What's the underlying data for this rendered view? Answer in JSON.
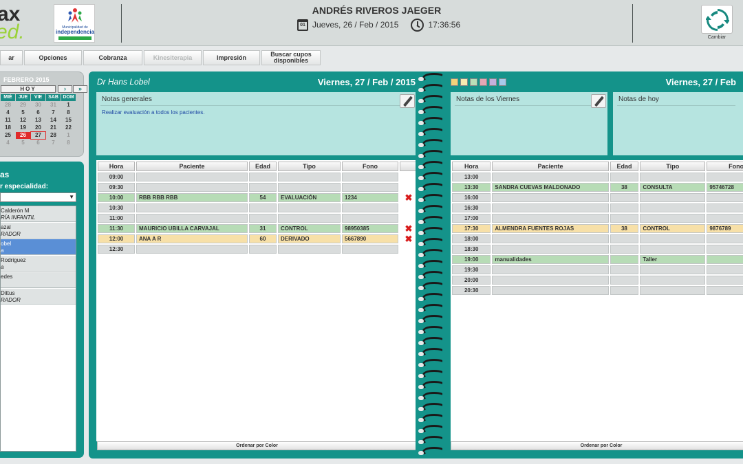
{
  "header": {
    "logo_line1": "ax",
    "logo_line2": "ed.",
    "muni_line1": "Municipalidad de",
    "muni_line2": "independencia",
    "user_name": "ANDRÉS RIVEROS JAEGER",
    "cal_icon_text": "01",
    "date": "Jueves, 26 / Feb / 2015",
    "time": "17:36:56",
    "cambiar_label": "Cambiar"
  },
  "toolbar": [
    {
      "label": "ar",
      "disabled": false
    },
    {
      "label": "Opciones",
      "disabled": false
    },
    {
      "label": "Cobranza",
      "disabled": false
    },
    {
      "label": "Kinesiterapia",
      "disabled": true
    },
    {
      "label": "Impresión",
      "disabled": false
    },
    {
      "label": "Buscar cupos disponibles",
      "disabled": false
    }
  ],
  "calendar": {
    "month": "FEBRERO 2015",
    "hoy": "HOY",
    "next": "›",
    "fast_next": "»",
    "headers": [
      "MIÉ",
      "JUE",
      "VIE",
      "SAB",
      "DOM"
    ],
    "weeks": [
      [
        "28",
        "29",
        "30",
        "31",
        "1"
      ],
      [
        "4",
        "5",
        "6",
        "7",
        "8"
      ],
      [
        "11",
        "12",
        "13",
        "14",
        "15"
      ],
      [
        "18",
        "19",
        "20",
        "21",
        "22"
      ],
      [
        "25",
        "26",
        "27",
        "28",
        "1"
      ],
      [
        "4",
        "5",
        "6",
        "7",
        "8"
      ]
    ]
  },
  "specialists": {
    "title": "as",
    "filter_label": "r especialidad:",
    "items": [
      {
        "name": "Calderón M",
        "spec": "RÍA INFANTIL"
      },
      {
        "name": "azal",
        "spec": "RADOR"
      },
      {
        "name": "obel",
        "spec": "a"
      },
      {
        "name": "Rodriguez",
        "spec": "a"
      },
      {
        "name": "edes",
        "spec": ""
      },
      {
        "name": "Dittus",
        "spec": "RADOR"
      }
    ]
  },
  "left_agenda": {
    "doctor": "Dr Hans Lobel",
    "date": "Viernes, 27 / Feb / 2015",
    "notes_title": "Notas generales",
    "notes_text": "Realizar evaluación a todos los pacientes.",
    "columns": [
      "Hora",
      "Paciente",
      "Edad",
      "Tipo",
      "Fono",
      ""
    ],
    "rows": [
      {
        "hora": "09:00",
        "paciente": "",
        "edad": "",
        "tipo": "",
        "fono": "",
        "del": "",
        "color": ""
      },
      {
        "hora": "09:30",
        "paciente": "",
        "edad": "",
        "tipo": "",
        "fono": "",
        "del": "",
        "color": ""
      },
      {
        "hora": "10:00",
        "paciente": "RBB RBB RBB",
        "edad": "54",
        "tipo": "EVALUACIÓN",
        "fono": "1234",
        "del": "✖",
        "color": "green"
      },
      {
        "hora": "10:30",
        "paciente": "",
        "edad": "",
        "tipo": "",
        "fono": "",
        "del": "",
        "color": ""
      },
      {
        "hora": "11:00",
        "paciente": "",
        "edad": "",
        "tipo": "",
        "fono": "",
        "del": "",
        "color": ""
      },
      {
        "hora": "11:30",
        "paciente": "MAURICIO UBILLA CARVAJAL",
        "edad": "31",
        "tipo": "CONTROL",
        "fono": "98950385",
        "del": "✖",
        "color": "green"
      },
      {
        "hora": "12:00",
        "paciente": "ANA A R",
        "edad": "60",
        "tipo": "DERIVADO",
        "fono": "5667890",
        "del": "✖",
        "color": "yellow"
      },
      {
        "hora": "12:30",
        "paciente": "",
        "edad": "",
        "tipo": "",
        "fono": "",
        "del": "",
        "color": ""
      }
    ],
    "order_label": "Ordenar por Color"
  },
  "right_agenda": {
    "date": "Viernes, 27 / Feb",
    "notes1_title": "Notas de los Viernes",
    "notes2_title": "Notas de hoy",
    "swatches": [
      "#f3d27a",
      "#f7eab0",
      "#b9dfb8",
      "#e4a7b5",
      "#c5b0dc",
      "#a9c9ea"
    ],
    "columns": [
      "Hora",
      "Paciente",
      "Edad",
      "Tipo",
      "Fono"
    ],
    "rows": [
      {
        "hora": "13:00",
        "paciente": "",
        "edad": "",
        "tipo": "",
        "fono": "",
        "color": ""
      },
      {
        "hora": "13:30",
        "paciente": "SANDRA CUEVAS MALDONADO",
        "edad": "38",
        "tipo": "CONSULTA",
        "fono": "95746728",
        "color": "green"
      },
      {
        "hora": "16:00",
        "paciente": "",
        "edad": "",
        "tipo": "",
        "fono": "",
        "color": ""
      },
      {
        "hora": "16:30",
        "paciente": "",
        "edad": "",
        "tipo": "",
        "fono": "",
        "color": ""
      },
      {
        "hora": "17:00",
        "paciente": "",
        "edad": "",
        "tipo": "",
        "fono": "",
        "color": ""
      },
      {
        "hora": "17:30",
        "paciente": "ALMENDRA FUENTES ROJAS",
        "edad": "38",
        "tipo": "CONTROL",
        "fono": "9876789",
        "color": "yellow"
      },
      {
        "hora": "18:00",
        "paciente": "",
        "edad": "",
        "tipo": "",
        "fono": "",
        "color": ""
      },
      {
        "hora": "18:30",
        "paciente": "",
        "edad": "",
        "tipo": "",
        "fono": "",
        "color": ""
      },
      {
        "hora": "19:00",
        "paciente": "manualidades",
        "edad": "",
        "tipo": "Taller",
        "fono": "",
        "color": "green"
      },
      {
        "hora": "19:30",
        "paciente": "",
        "edad": "",
        "tipo": "",
        "fono": "",
        "color": ""
      },
      {
        "hora": "20:00",
        "paciente": "",
        "edad": "",
        "tipo": "",
        "fono": "",
        "color": ""
      },
      {
        "hora": "20:30",
        "paciente": "",
        "edad": "",
        "tipo": "",
        "fono": "",
        "color": ""
      }
    ],
    "order_label": "Ordenar por Color"
  }
}
